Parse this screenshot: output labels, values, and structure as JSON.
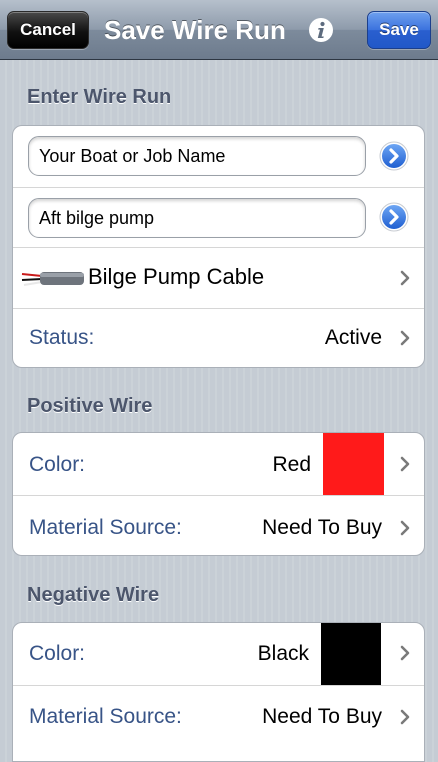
{
  "navbar": {
    "cancel_label": "Cancel",
    "title": "Save Wire Run",
    "save_label": "Save",
    "info_icon": "info-icon"
  },
  "enter_wire_run": {
    "header": "Enter Wire Run",
    "job_name_value": "Your Boat or Job Name",
    "run_name_value": "Aft bilge pump",
    "cable_label": "Bilge Pump Cable",
    "status_label": "Status:",
    "status_value": "Active"
  },
  "positive_wire": {
    "header": "Positive Wire",
    "color_label": "Color:",
    "color_value": "Red",
    "color_swatch": "#ff1a1a",
    "material_label": "Material Source:",
    "material_value": "Need To Buy"
  },
  "negative_wire": {
    "header": "Negative Wire",
    "color_label": "Color:",
    "color_value": "Black",
    "color_swatch": "#000000",
    "material_label": "Material Source:",
    "material_value": "Need To Buy"
  },
  "colors": {
    "label_blue": "#385487",
    "header_gray": "#4c566c",
    "save_blue": "#3b72de"
  }
}
